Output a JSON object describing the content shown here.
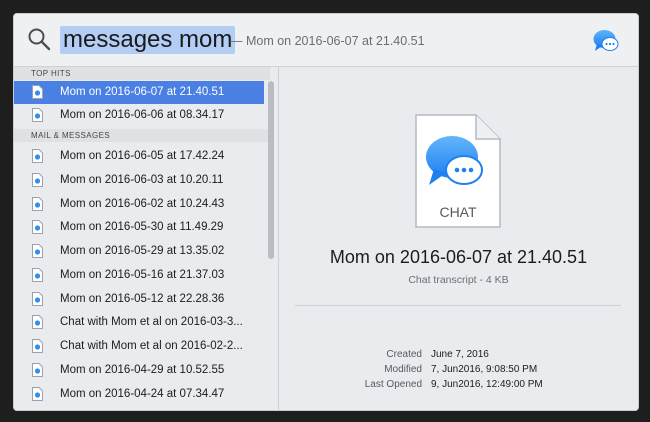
{
  "search": {
    "query": "messages mom",
    "hint": "— Mom on 2016-06-07 at 21.40.51"
  },
  "results": {
    "top_hits_header": "TOP HITS",
    "top_hits": [
      "Mom on 2016-06-07 at 21.40.51",
      "Mom on 2016-06-06 at 08.34.17"
    ],
    "mail_header": "MAIL & MESSAGES",
    "mail_messages": [
      "Mom on 2016-06-05 at 17.42.24",
      "Mom on 2016-06-03 at 10.20.11",
      "Mom on 2016-06-02 at 10.24.43",
      "Mom on 2016-05-30 at 11.49.29",
      "Mom on 2016-05-29 at 13.35.02",
      "Mom on 2016-05-16 at 21.37.03",
      "Mom on 2016-05-12 at 22.28.36",
      "Chat with Mom et al on 2016-03-3...",
      "Chat with Mom et al on 2016-02-2...",
      "Mom on 2016-04-29 at 10.52.55",
      "Mom on 2016-04-24 at 07.34.47"
    ]
  },
  "preview": {
    "icon_label": "CHAT",
    "title": "Mom on 2016-06-07 at 21.40.51",
    "subtitle": "Chat transcript - 4 KB",
    "meta": [
      {
        "key": "Created",
        "value": "June 7, 2016"
      },
      {
        "key": "Modified",
        "value": "7, Jun2016, 9:08:50 PM"
      },
      {
        "key": "Last Opened",
        "value": "9, Jun2016, 12:49:00 PM"
      }
    ]
  },
  "colors": {
    "selection": "#4a7fe4",
    "query_highlight": "#b3cdf5",
    "messages_bubble": "#2f8ff7"
  },
  "icons": {
    "search": "magnifier-icon",
    "app": "messages-bubble-icon",
    "result": "document-icon",
    "preview": "chat-document-icon"
  }
}
